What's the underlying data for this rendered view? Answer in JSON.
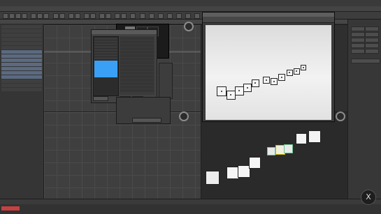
{
  "menu": {
    "items": [
      "",
      "",
      "",
      "",
      "",
      "",
      "",
      "",
      "",
      "",
      ""
    ]
  },
  "explorer": {
    "rows": [
      "",
      "",
      "",
      "",
      "",
      "",
      "",
      "",
      "",
      "",
      "",
      "",
      "",
      "",
      "",
      ""
    ]
  },
  "render_window": {
    "title": ""
  },
  "dialog": {
    "title": "",
    "list_items": [
      "",
      "",
      "",
      "",
      "",
      "",
      "",
      "",
      "",
      "",
      ""
    ],
    "buttons": [
      "",
      "",
      ""
    ]
  },
  "panel_dialog": {
    "labels": [
      "",
      "",
      ""
    ]
  },
  "status": {
    "text": ""
  },
  "nav": {
    "logo_glyph": "X"
  },
  "colors": {
    "selection_blue": "#3aa0f5",
    "status_red": "#c64040",
    "wire_green": "#6fbf8f",
    "wire_yellow": "#d4b800"
  }
}
